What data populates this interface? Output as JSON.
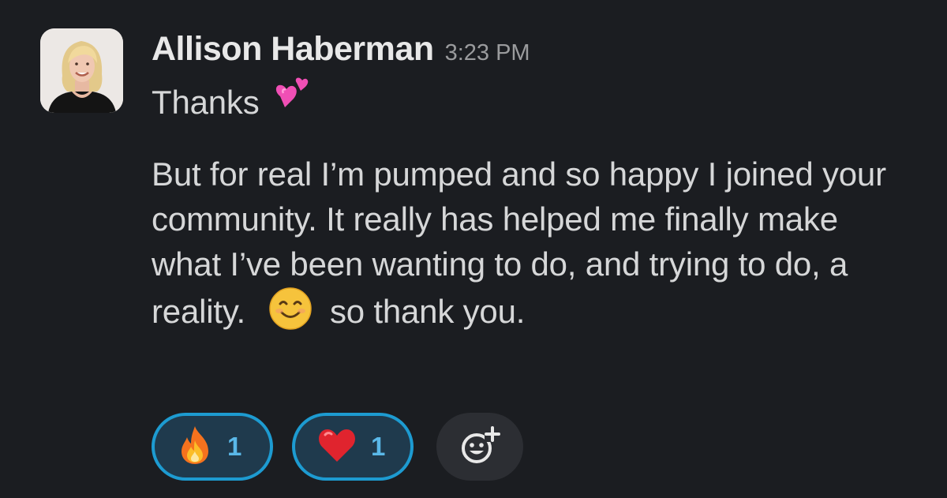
{
  "message": {
    "sender": "Allison Haberman",
    "time": "3:23 PM",
    "line1_text": "Thanks",
    "line1_emoji": "two-hearts-icon",
    "para2_before": "But for real I’m pumped and so happy I joined your community. It really has helped me finally make what I’ve been wanting to do, and trying to do, a reality.",
    "para2_emoji": "smiling-face-icon",
    "para2_after": "so thank you."
  },
  "reactions": [
    {
      "emoji": "fire-icon",
      "count": "1"
    },
    {
      "emoji": "red-heart-icon",
      "count": "1"
    }
  ],
  "colors": {
    "background": "#1b1d21",
    "reaction_border": "#1d9bd1",
    "reaction_count": "#5ab8e8"
  }
}
